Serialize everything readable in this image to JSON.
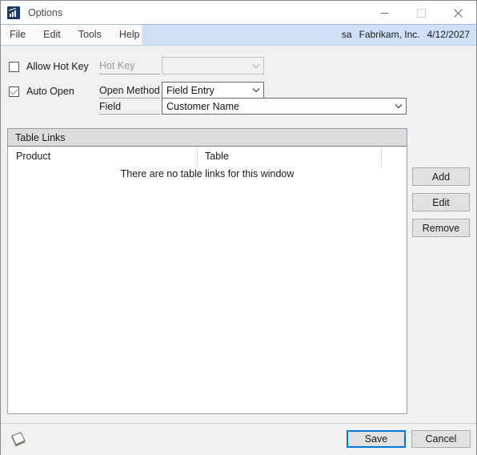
{
  "window": {
    "title": "Options",
    "app_icon": "chart-app-icon",
    "controls": [
      {
        "name": "minimize",
        "glyph": "minimize-icon",
        "enabled": true
      },
      {
        "name": "maximize",
        "glyph": "maximize-icon",
        "enabled": false
      },
      {
        "name": "close",
        "glyph": "close-icon",
        "enabled": true
      }
    ]
  },
  "menubar": {
    "items": [
      {
        "label": "File"
      },
      {
        "label": "Edit"
      },
      {
        "label": "Tools"
      },
      {
        "label": "Help"
      }
    ],
    "user": "sa",
    "company": "Fabrikam, Inc.",
    "date": "4/12/2027"
  },
  "options": {
    "allow_hot_key": {
      "label": "Allow Hot Key",
      "checked": false
    },
    "auto_open": {
      "label": "Auto Open",
      "checked": true
    },
    "hot_key": {
      "label": "Hot Key",
      "value": "",
      "enabled": false
    },
    "open_method": {
      "label": "Open Method",
      "value": "Field Entry",
      "enabled": true
    },
    "field": {
      "label": "Field",
      "value": "Customer Name",
      "enabled": true
    }
  },
  "table_links": {
    "title": "Table Links",
    "columns": [
      "Product",
      "Table"
    ],
    "rows": [],
    "empty_message": "There are no table links for this window"
  },
  "side_buttons": [
    {
      "label": "Add"
    },
    {
      "label": "Edit"
    },
    {
      "label": "Remove"
    }
  ],
  "footer": {
    "note_icon": "note-icon",
    "save_label": "Save",
    "cancel_label": "Cancel"
  },
  "colors": {
    "accent": "#0078d7",
    "menubar": "#cfe0f7",
    "panel_header": "#dcdcdc",
    "button_face": "#e1e1e1"
  }
}
